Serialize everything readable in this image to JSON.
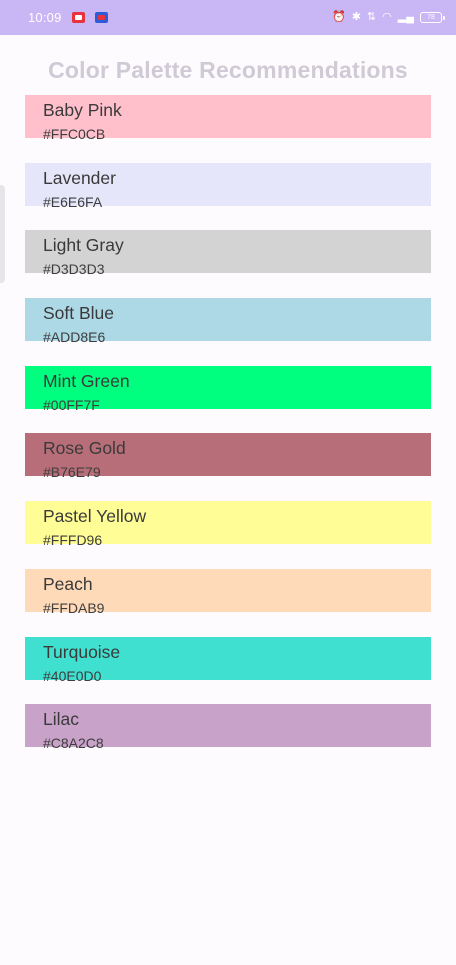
{
  "status_bar": {
    "time": "10:09",
    "battery": "78"
  },
  "title": "Color Palette Recommendations",
  "palette": [
    {
      "name": "Baby Pink",
      "hex": "#FFC0CB",
      "color": "#FFC0CB"
    },
    {
      "name": "Lavender",
      "hex": "#E6E6FA",
      "color": "#E6E6FA"
    },
    {
      "name": "Light Gray",
      "hex": "#D3D3D3",
      "color": "#D3D3D3"
    },
    {
      "name": "Soft Blue",
      "hex": "#ADD8E6",
      "color": "#ADD8E6"
    },
    {
      "name": "Mint Green",
      "hex": "#00FF7F",
      "color": "#00FF7F"
    },
    {
      "name": "Rose Gold",
      "hex": "#B76E79",
      "color": "#B76E79"
    },
    {
      "name": "Pastel Yellow",
      "hex": "#FFFD96",
      "color": "#FFFD96"
    },
    {
      "name": "Peach",
      "hex": "#FFDAB9",
      "color": "#FFDAB9"
    },
    {
      "name": "Turquoise",
      "hex": "#40E0D0",
      "color": "#40E0D0"
    },
    {
      "name": "Lilac",
      "hex": "#C8A2C8",
      "color": "#C8A2C8"
    }
  ]
}
